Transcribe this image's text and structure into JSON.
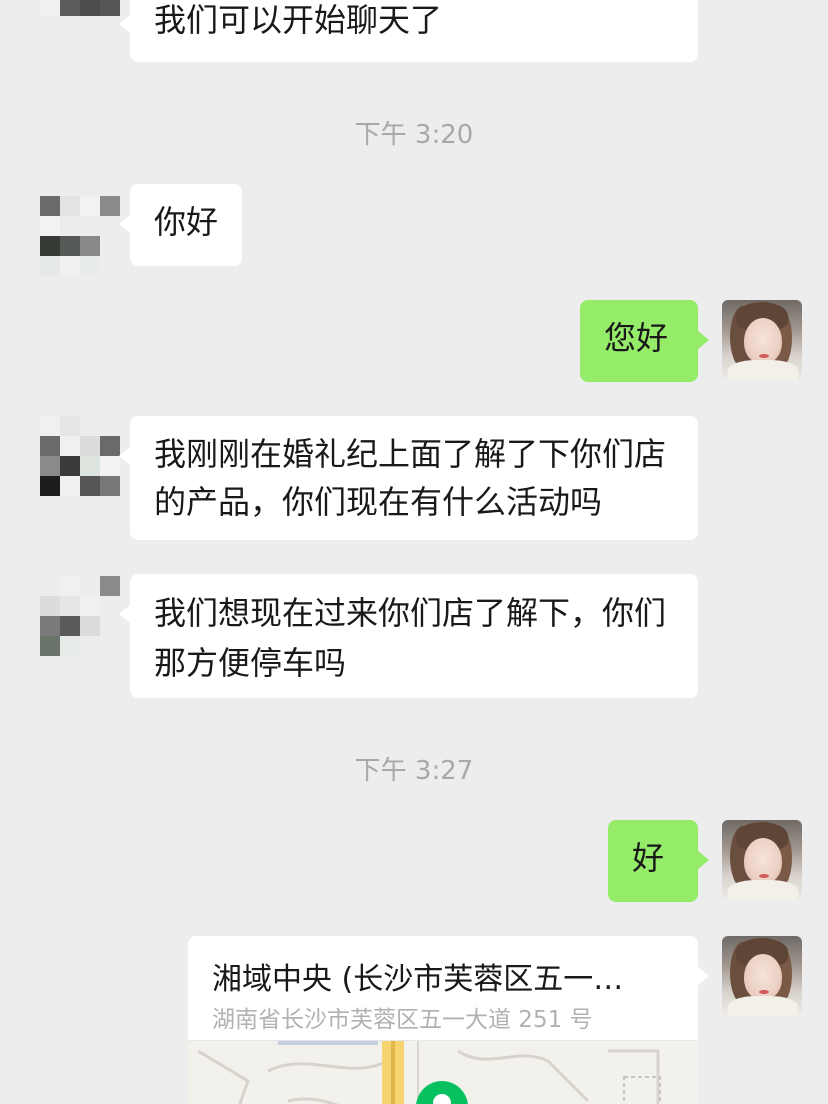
{
  "chat": {
    "messages": [
      {
        "side": "left",
        "text": "我们可以开始聊天了"
      },
      {
        "side": "left",
        "text": "你好"
      },
      {
        "side": "right",
        "text": "您好"
      },
      {
        "side": "left",
        "text": "我刚刚在婚礼纪上面了解了下你们店的产品，你们现在有什么活动吗"
      },
      {
        "side": "left",
        "text": "我们想现在过来你们店了解下，你们那方便停车吗"
      },
      {
        "side": "right",
        "text": "好"
      }
    ],
    "timestamps": [
      "下午 3:20",
      "下午 3:27"
    ],
    "location": {
      "title": "湘域中央 (长沙市芙蓉区五一…",
      "address": "湖南省长沙市芙蓉区五一大道 251 号",
      "pin_icon": "map-pin-icon"
    }
  },
  "colors": {
    "background": "#ededed",
    "bubble_incoming": "#ffffff",
    "bubble_outgoing": "#95ec69",
    "timestamp": "#a8a8a8",
    "pin": "#07c160"
  }
}
